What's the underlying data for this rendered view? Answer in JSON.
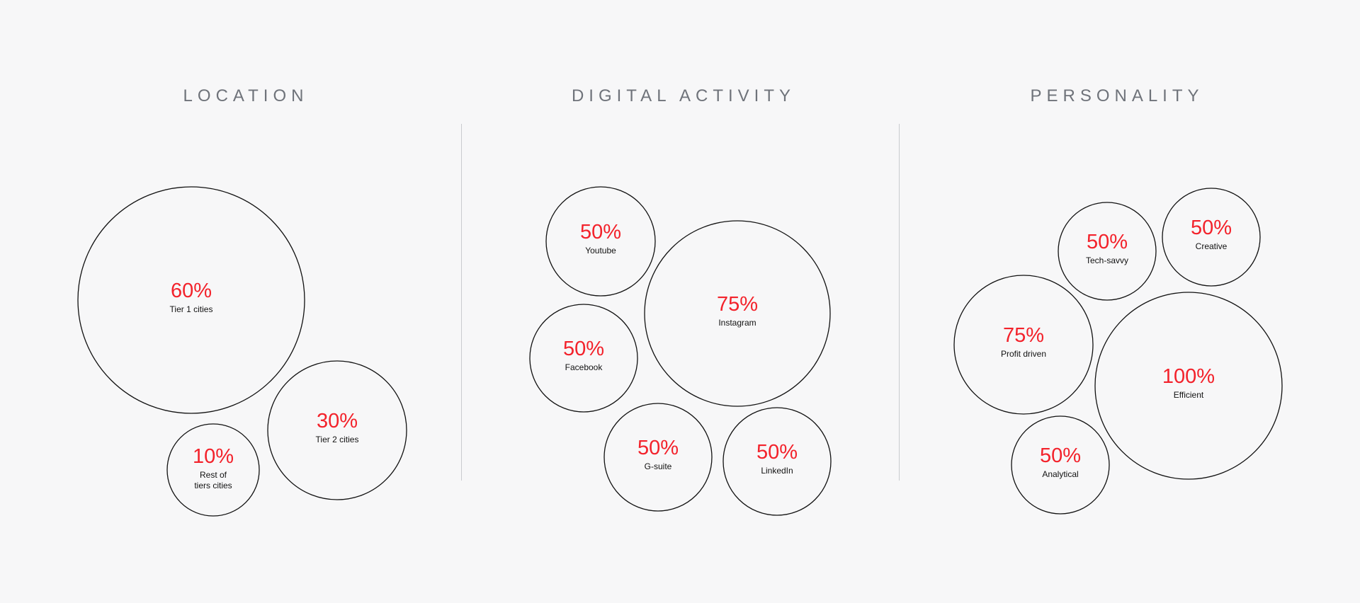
{
  "colors": {
    "background": "#f7f7f8",
    "value": "#f3222b",
    "label": "#111111",
    "title": "#6f737a",
    "divider": "#c9cbcf"
  },
  "chart_data": [
    {
      "type": "bubble",
      "title": "LOCATION",
      "bubbles": [
        {
          "value": "60%",
          "label": "Tier 1 cities",
          "size": 60
        },
        {
          "value": "30%",
          "label": "Tier 2 cities",
          "size": 30
        },
        {
          "value": "10%",
          "label": "Rest of tiers cities",
          "size": 10
        }
      ]
    },
    {
      "type": "bubble",
      "title": "DIGITAL ACTIVITY",
      "bubbles": [
        {
          "value": "50%",
          "label": "Youtube",
          "size": 50
        },
        {
          "value": "75%",
          "label": "Instagram",
          "size": 75
        },
        {
          "value": "50%",
          "label": "Facebook",
          "size": 50
        },
        {
          "value": "50%",
          "label": "G-suite",
          "size": 50
        },
        {
          "value": "50%",
          "label": "LinkedIn",
          "size": 50
        }
      ]
    },
    {
      "type": "bubble",
      "title": "PERSONALITY",
      "bubbles": [
        {
          "value": "50%",
          "label": "Tech-savvy",
          "size": 50
        },
        {
          "value": "50%",
          "label": "Creative",
          "size": 50
        },
        {
          "value": "75%",
          "label": "Profit driven",
          "size": 75
        },
        {
          "value": "100%",
          "label": "Efficient",
          "size": 100
        },
        {
          "value": "50%",
          "label": "Analytical",
          "size": 50
        }
      ]
    }
  ]
}
